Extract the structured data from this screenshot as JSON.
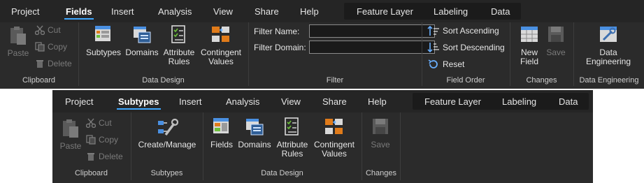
{
  "ribbon_fields": {
    "tabs": [
      "Project",
      "Fields",
      "Insert",
      "Analysis",
      "View",
      "Share",
      "Help"
    ],
    "active_tab": "Fields",
    "contextual_tabs": [
      "Feature Layer",
      "Labeling",
      "Data"
    ],
    "clipboard": {
      "paste": "Paste",
      "cut": "Cut",
      "copy": "Copy",
      "delete": "Delete",
      "group": "Clipboard"
    },
    "data_design": {
      "subtypes": "Subtypes",
      "domains": "Domains",
      "attribute_rules_1": "Attribute",
      "attribute_rules_2": "Rules",
      "contingent_values_1": "Contingent",
      "contingent_values_2": "Values",
      "group": "Data Design"
    },
    "filter": {
      "name_label": "Filter Name:",
      "name_value": "",
      "domain_label": "Filter Domain:",
      "domain_value": "",
      "group": "Filter"
    },
    "field_order": {
      "sort_asc": "Sort Ascending",
      "sort_desc": "Sort Descending",
      "reset": "Reset",
      "group": "Field Order"
    },
    "changes": {
      "new_field_1": "New",
      "new_field_2": "Field",
      "save": "Save",
      "group": "Changes"
    },
    "data_engineering": {
      "button_1": "Data",
      "button_2": "Engineering",
      "group": "Data Engineering"
    }
  },
  "ribbon_subtypes": {
    "tabs": [
      "Project",
      "Subtypes",
      "Insert",
      "Analysis",
      "View",
      "Share",
      "Help"
    ],
    "active_tab": "Subtypes",
    "contextual_tabs": [
      "Feature Layer",
      "Labeling",
      "Data"
    ],
    "clipboard": {
      "paste": "Paste",
      "cut": "Cut",
      "copy": "Copy",
      "delete": "Delete",
      "group": "Clipboard"
    },
    "subtypes": {
      "create_manage": "Create/Manage",
      "group": "Subtypes"
    },
    "data_design": {
      "fields": "Fields",
      "domains": "Domains",
      "attribute_rules_1": "Attribute",
      "attribute_rules_2": "Rules",
      "contingent_values_1": "Contingent",
      "contingent_values_2": "Values",
      "group": "Data Design"
    },
    "changes": {
      "save": "Save",
      "group": "Changes"
    }
  },
  "colors": {
    "accent": "#3fa7ff",
    "ribbon_bg": "#2b2b2b",
    "tabbar_bg": "#252525",
    "disabled_text": "#7a7a7a"
  }
}
